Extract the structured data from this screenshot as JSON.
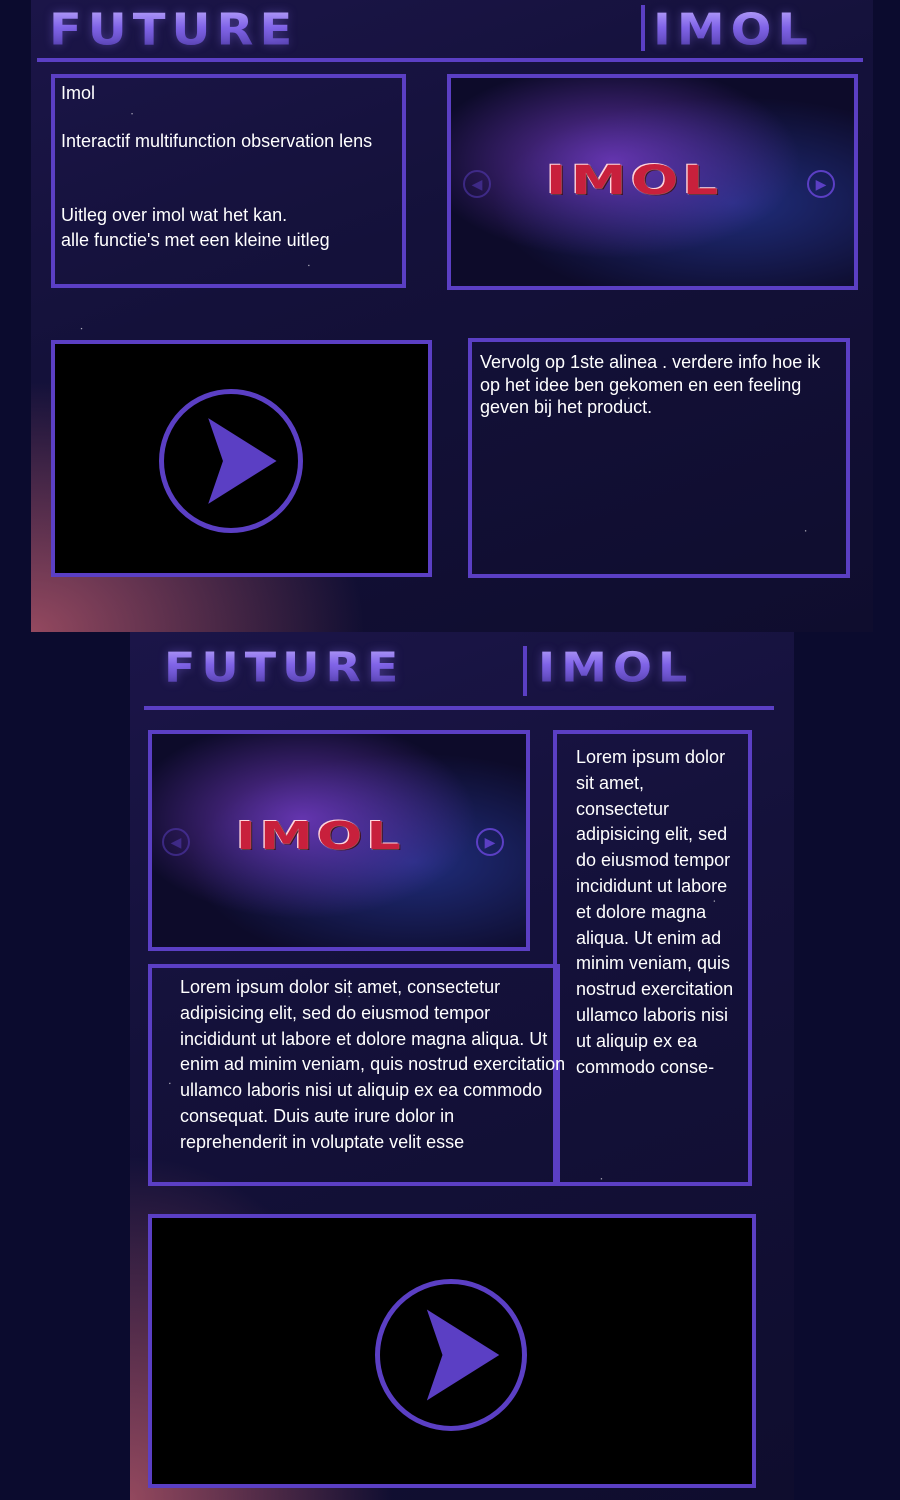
{
  "header": {
    "title_left": "FUTURE",
    "title_right": "IMOL"
  },
  "page1": {
    "intro": {
      "title": "Imol",
      "line1": "Interactif multifunction observation lens",
      "line2": "Uitleg over imol wat het kan.",
      "line3": "alle functie's met een kleine uitleg"
    },
    "slider": {
      "brand": "IMOL",
      "prev_icon": "chevron-left-icon",
      "next_icon": "chevron-right-icon"
    },
    "video": {
      "icon": "play-icon"
    },
    "info_text": "Vervolg op 1ste alinea . verdere info hoe ik op het idee ben gekomen en een feeling geven bij het product."
  },
  "page2": {
    "slider": {
      "brand": "IMOL"
    },
    "column_text": "Lorem ipsum dolor sit amet, consectetur adipisicing elit, sed do eiusmod tempor incididunt ut labore et dolore magna aliqua. Ut enim ad minim veniam, quis nostrud exercitation ullamco laboris nisi ut aliquip ex ea commodo conse-",
    "body_text": "Lorem ipsum dolor sit amet, consectetur adipisicing elit, sed do eiusmod tempor incididunt ut labore et dolore magna aliqua. Ut enim ad minim veniam, quis nostrud exercitation ullamco laboris nisi ut aliquip ex ea commodo consequat. Duis aute irure dolor in reprehenderit in voluptate velit esse",
    "video": {
      "icon": "play-icon"
    }
  },
  "colors": {
    "accent": "#5b3fc4",
    "background": "#14113a",
    "brand_red": "#c8203c"
  }
}
